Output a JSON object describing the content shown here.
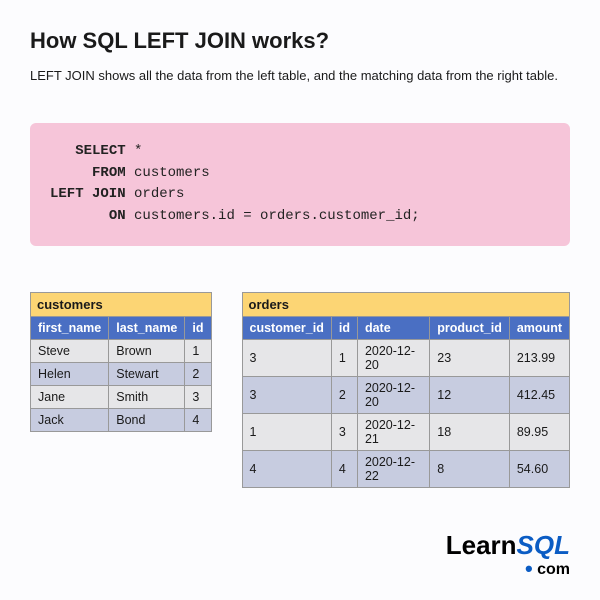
{
  "title": "How SQL LEFT JOIN works?",
  "subtitle": "LEFT JOIN shows all the data from the left table, and the matching data from the right table.",
  "code": {
    "kw_select": "SELECT",
    "select_rest": " *",
    "kw_from": "FROM",
    "from_rest": " customers",
    "kw_leftjoin": "LEFT JOIN",
    "leftjoin_rest": " orders",
    "kw_on": "ON",
    "on_rest": " customers.id = orders.customer_id;"
  },
  "customers": {
    "caption": "customers",
    "headers": [
      "first_name",
      "last_name",
      "id"
    ],
    "rows": [
      [
        "Steve",
        "Brown",
        "1"
      ],
      [
        "Helen",
        "Stewart",
        "2"
      ],
      [
        "Jane",
        "Smith",
        "3"
      ],
      [
        "Jack",
        "Bond",
        "4"
      ]
    ]
  },
  "orders": {
    "caption": "orders",
    "headers": [
      "customer_id",
      "id",
      "date",
      "product_id",
      "amount"
    ],
    "rows": [
      [
        "3",
        "1",
        "2020-12-20",
        "23",
        "213.99"
      ],
      [
        "3",
        "2",
        "2020-12-20",
        "12",
        "412.45"
      ],
      [
        "1",
        "3",
        "2020-12-21",
        "18",
        "89.95"
      ],
      [
        "4",
        "4",
        "2020-12-22",
        "8",
        "54.60"
      ]
    ]
  },
  "logo": {
    "learn": "Learn",
    "sql": "SQL",
    "dot": "•",
    "com": " com"
  }
}
